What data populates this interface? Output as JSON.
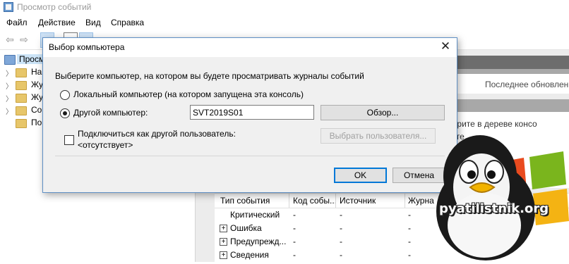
{
  "window": {
    "title": "Просмотр событий"
  },
  "menu": [
    "Файл",
    "Действие",
    "Вид",
    "Справка"
  ],
  "tree": {
    "root": "Просм",
    "items": [
      "На",
      "Жу",
      "Жу",
      "Со",
      "По"
    ]
  },
  "right_pane": {
    "header_text": "Последнее обновлен",
    "hint_line1": "берите в дереве консо",
    "hint_line2": "тоте"
  },
  "events_table": {
    "columns": [
      "Тип события",
      "Код собы...",
      "Источник",
      "Журна"
    ],
    "rows": [
      {
        "type": "Критический",
        "code": "-",
        "source": "-",
        "log": "-",
        "expandable": false
      },
      {
        "type": "Ошибка",
        "code": "-",
        "source": "-",
        "log": "-",
        "expandable": true
      },
      {
        "type": "Предупрежд...",
        "code": "-",
        "source": "-",
        "log": "-",
        "expandable": true
      },
      {
        "type": "Сведения",
        "code": "-",
        "source": "-",
        "log": "-",
        "expandable": true
      }
    ]
  },
  "dialog": {
    "title": "Выбор компьютера",
    "prompt": "Выберите компьютер, на котором вы будете просматривать журналы событий",
    "radio_local": "Локальный компьютер (на котором запущена эта консоль)",
    "radio_other": "Другой компьютер:",
    "computer_value": "SVT2019S01",
    "browse_button": "Обзор...",
    "connect_as": "Подключиться как другой пользователь:",
    "connect_as_value": "<отсутствует>",
    "select_user_button": "Выбрать пользователя...",
    "ok_button": "OK",
    "cancel_button": "Отмена",
    "close_glyph": "✕"
  },
  "watermark": {
    "text": "pyatilistnik.org"
  },
  "colors": {
    "accent": "#0078d7",
    "selection": "#cce4f7",
    "dialog_bg": "#f0f0f0"
  }
}
